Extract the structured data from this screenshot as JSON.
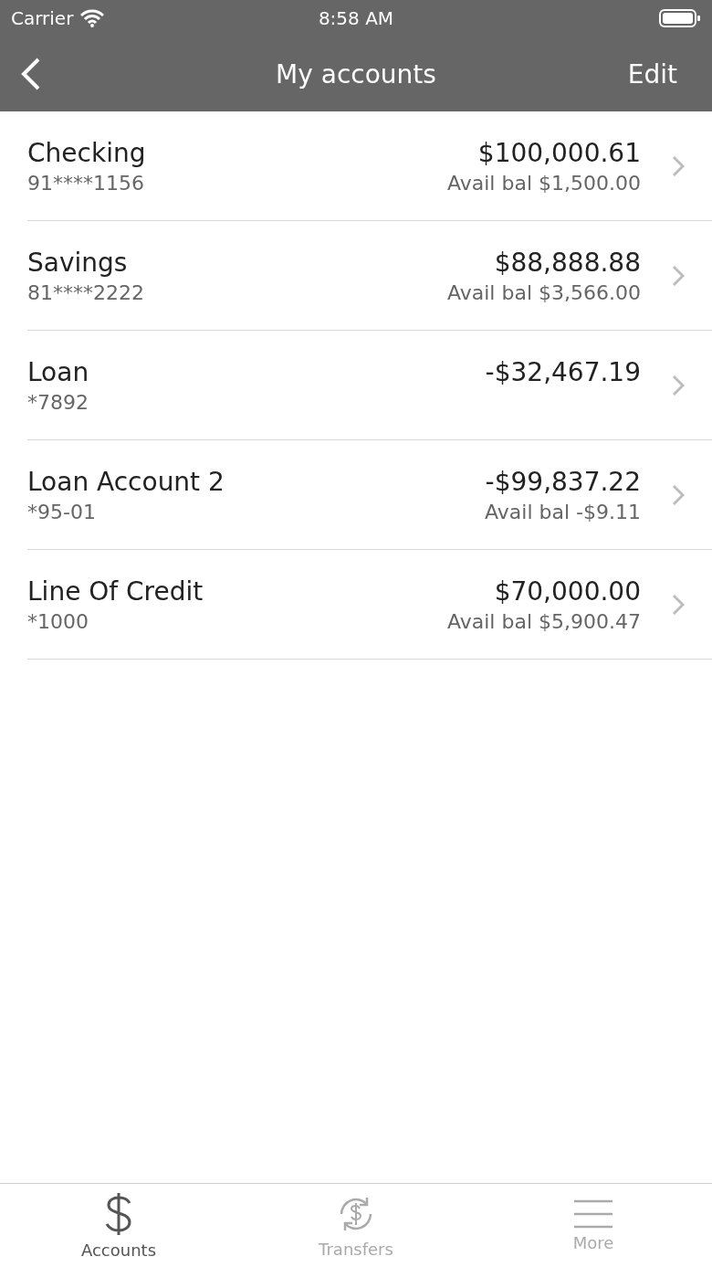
{
  "status_bar": {
    "carrier": "Carrier",
    "time": "8:58 AM"
  },
  "nav": {
    "title": "My accounts",
    "action": "Edit"
  },
  "accounts": [
    {
      "name": "Checking",
      "number": "91****1156",
      "balance": "$100,000.61",
      "available": "Avail bal $1,500.00"
    },
    {
      "name": "Savings",
      "number": "81****2222",
      "balance": "$88,888.88",
      "available": "Avail bal $3,566.00"
    },
    {
      "name": "Loan",
      "number": "*7892",
      "balance": "-$32,467.19"
    },
    {
      "name": "Loan Account 2",
      "number": "*95-01",
      "balance": "-$99,837.22",
      "available": "Avail bal -$9.11"
    },
    {
      "name": "Line Of Credit",
      "number": "*1000",
      "balance": "$70,000.00",
      "available": "Avail bal $5,900.47"
    }
  ],
  "tabs": [
    {
      "kind": "dollar",
      "label": "Accounts",
      "selected": true
    },
    {
      "kind": "transfer",
      "label": "Transfers",
      "selected": false
    },
    {
      "kind": "menu",
      "label": "More",
      "selected": false
    }
  ]
}
